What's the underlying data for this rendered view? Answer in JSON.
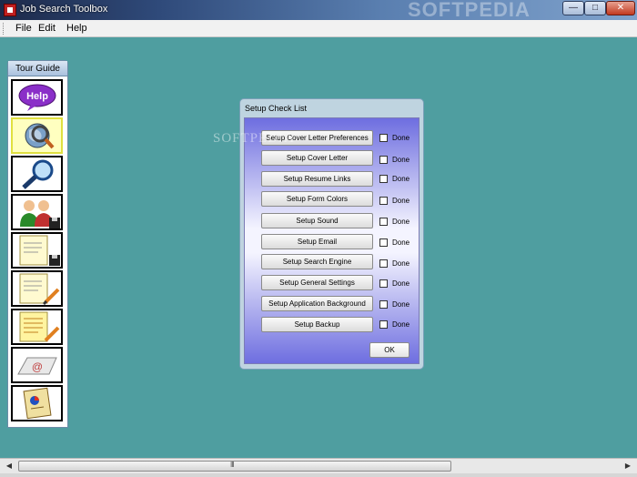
{
  "window": {
    "title": "Job Search Toolbox",
    "watermark": "SOFTPEDIA",
    "minimize_label": "—",
    "maximize_label": "□",
    "close_label": "✕"
  },
  "menu": {
    "items": [
      {
        "label": "File"
      },
      {
        "label": "Edit"
      },
      {
        "label": "Help"
      }
    ]
  },
  "tour_guide": {
    "title": "Tour Guide",
    "tools": [
      {
        "icon": "help-bubble-icon",
        "label": "Help"
      },
      {
        "icon": "globe-search-icon"
      },
      {
        "icon": "magnifier-icon"
      },
      {
        "icon": "contacts-save-icon"
      },
      {
        "icon": "document-save-icon"
      },
      {
        "icon": "document-edit-icon"
      },
      {
        "icon": "notes-edit-icon"
      },
      {
        "icon": "email-icon"
      },
      {
        "icon": "document-report-icon"
      }
    ]
  },
  "dialog": {
    "title": "Setup Check List",
    "watermark": "SOFTPEDIA",
    "items": [
      {
        "label": "Setup Cover Letter Preferences",
        "done_label": "Done",
        "done": false
      },
      {
        "label": "Setup Cover Letter",
        "done_label": "Done",
        "done": false
      },
      {
        "label": "Setup Resume Links",
        "done_label": "Done",
        "done": false
      },
      {
        "label": "Setup Form Colors",
        "done_label": "Done",
        "done": false
      },
      {
        "label": "Setup Sound",
        "done_label": "Done",
        "done": false
      },
      {
        "label": "Setup Email",
        "done_label": "Done",
        "done": false
      },
      {
        "label": "Setup Search Engine",
        "done_label": "Done",
        "done": false
      },
      {
        "label": "Setup General Settings",
        "done_label": "Done",
        "done": false
      },
      {
        "label": "Setup Application Background",
        "done_label": "Done",
        "done": false
      },
      {
        "label": "Setup Backup",
        "done_label": "Done",
        "done": false
      }
    ],
    "ok_label": "OK"
  },
  "scrollbar": {
    "left_arrow": "◀",
    "right_arrow": "▶",
    "grip": "III"
  }
}
